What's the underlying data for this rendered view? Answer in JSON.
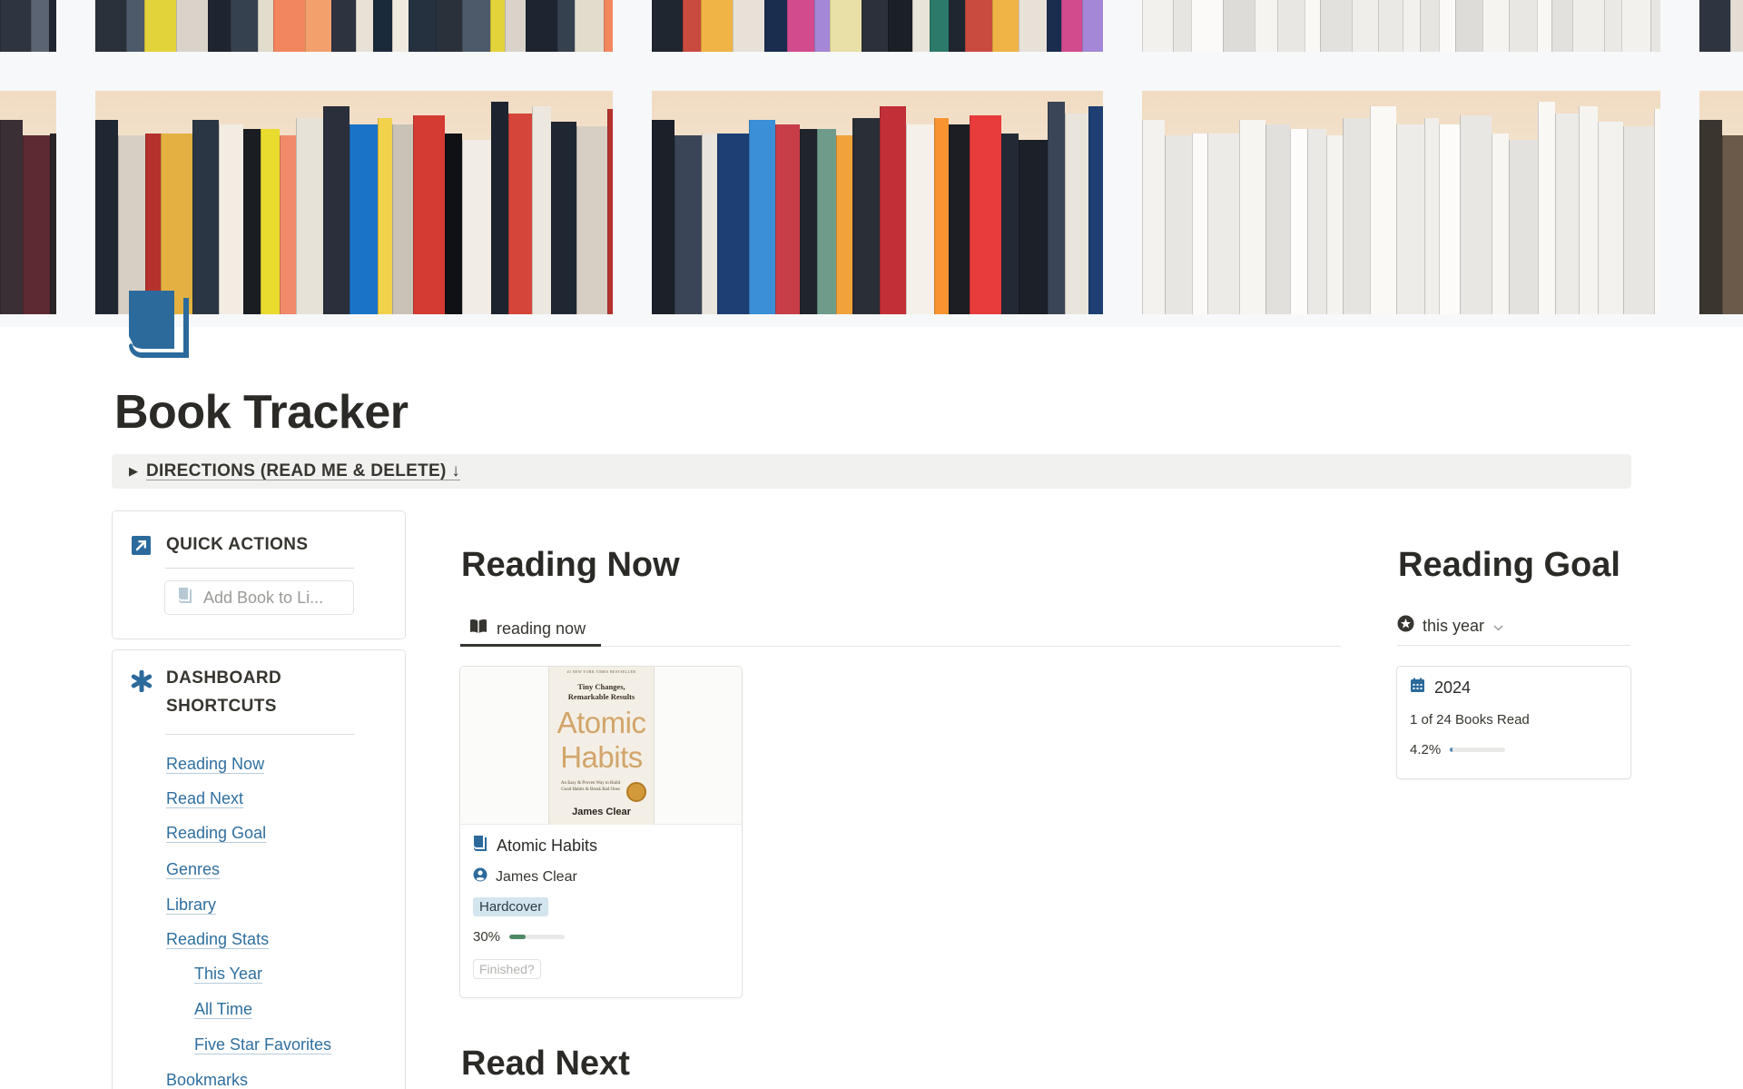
{
  "page": {
    "title": "Book Tracker",
    "directions_toggle": "DIRECTIONS (READ ME & DELETE) ↓"
  },
  "colors": {
    "accent_blue": "#2f6f9f",
    "icon_blue": "#2c6a9c",
    "progress_green": "#4f8a67",
    "goal_progress_blue": "#4f87b3",
    "pill_blue": "#d3e5ef"
  },
  "quick_actions": {
    "title": "QUICK ACTIONS",
    "icon": "arrow-up-right-square-icon",
    "add_book_button": "Add Book to Li..."
  },
  "dashboard_shortcuts": {
    "title_line1": "DASHBOARD",
    "title_line2": "SHORTCUTS",
    "icon": "asterisk-icon",
    "links": [
      {
        "label": "Reading Now"
      },
      {
        "label": "Read Next"
      },
      {
        "label": "Reading Goal"
      },
      {
        "label": "Genres"
      },
      {
        "label": "Library"
      },
      {
        "label": "Reading Stats"
      },
      {
        "label": "This Year"
      },
      {
        "label": "All Time"
      },
      {
        "label": "Five Star Favorites"
      },
      {
        "label": "Bookmarks"
      }
    ]
  },
  "reading_now": {
    "heading": "Reading Now",
    "view_tab": "reading now",
    "card": {
      "cover": {
        "top_text": "#1 NEW YORK TIMES BESTSELLER",
        "subtitle_line1": "Tiny Changes,",
        "subtitle_line2": "Remarkable Results",
        "title_line1": "Atomic",
        "title_line2": "Habits",
        "tagline": "An Easy & Proven Way to Build Good Habits & Break Bad Ones",
        "author": "James Clear"
      },
      "title": "Atomic Habits",
      "author": "James Clear",
      "format": "Hardcover",
      "progress_label": "30%",
      "progress": 0.3,
      "finished_button": "Finished?"
    }
  },
  "read_next": {
    "heading": "Read Next"
  },
  "reading_goal": {
    "heading": "Reading Goal",
    "filter_label": "this year",
    "card": {
      "year": "2024",
      "books_read_text": "1 of 24 Books Read",
      "progress_label": "4.2%",
      "progress": 0.042
    }
  }
}
